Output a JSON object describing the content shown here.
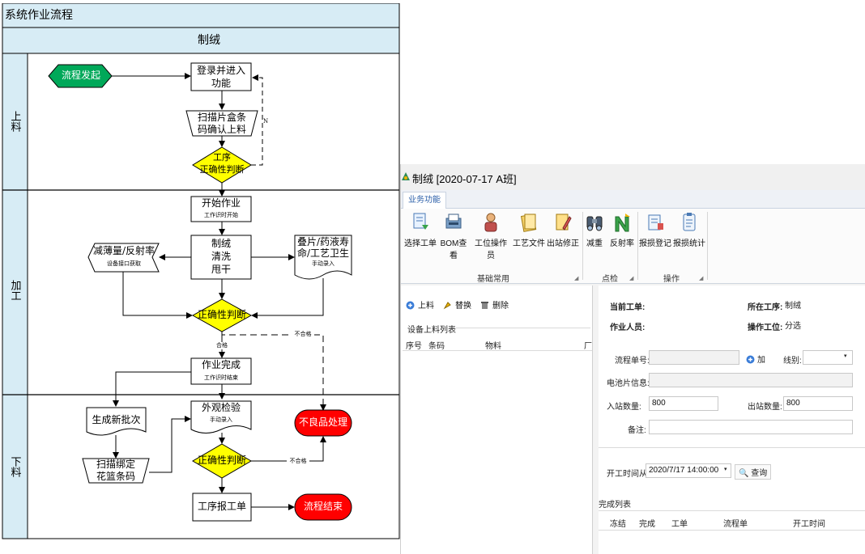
{
  "flowchart": {
    "title": "系统作业流程",
    "column_header": "制绒",
    "lanes": [
      "上料",
      "加工",
      "下料"
    ],
    "nodes": {
      "start": "流程发起",
      "login": [
        "登录并进入",
        "功能"
      ],
      "scan": [
        "扫描片盒条",
        "码确认上料"
      ],
      "check1": [
        "工序",
        "正确性判断"
      ],
      "check1_no": "N",
      "begin": "开始作业",
      "begin_sub": "工作识时开始",
      "process": [
        "制绒",
        "清洗",
        "甩干"
      ],
      "thin": "减薄量/反射率",
      "thin_sub": "设备接口获取",
      "stack": [
        "叠片/药液寿",
        "命/工艺卫生"
      ],
      "stack_sub": "手动录入",
      "check2": "正确性判断",
      "fail_label1": "不合格",
      "pass_label": "合格",
      "done": "作业完成",
      "done_sub": "工作识时结束",
      "new_batch": "生成新批次",
      "bind": [
        "扫描绑定",
        "花篮条码"
      ],
      "inspect": "外观检验",
      "inspect_sub": "手动录入",
      "defect": "不良品处理",
      "check3": "正确性判断",
      "fail_label2": "不合格",
      "report": "工序报工单",
      "end": "流程结束"
    },
    "colors": {
      "header_fill": "#d7ecf5",
      "start_fill": "#00a859",
      "diamond_fill": "#ffff00",
      "terminal_red": "#ff0000"
    }
  },
  "app": {
    "title": "制绒 [2020-07-17 A班]",
    "ribbon_tab": "业务功能",
    "ribbon_buttons": [
      {
        "label": "选择工单",
        "icon": "select-order-icon"
      },
      {
        "label": "BOM查看",
        "icon": "bom-icon"
      },
      {
        "label": "工位操作员",
        "icon": "operator-icon"
      },
      {
        "label": "工艺文件",
        "icon": "process-file-icon"
      },
      {
        "label": "出站修正",
        "icon": "exit-fix-icon"
      },
      {
        "label": "减重",
        "icon": "binoculars-icon"
      },
      {
        "label": "反射率",
        "icon": "reflectance-icon"
      },
      {
        "label": "报损登记",
        "icon": "loss-register-icon"
      },
      {
        "label": "报损统计",
        "icon": "loss-stats-icon"
      }
    ],
    "ribbon_groups": [
      "基础常用",
      "点检",
      "操作"
    ],
    "left_panel": {
      "buttons": [
        "上料",
        "替换",
        "删除"
      ],
      "list_title": "设备上料列表",
      "columns": [
        "序号",
        "条码",
        "物料",
        "厂"
      ]
    },
    "right_panel": {
      "current_order_label": "当前工单:",
      "current_order_value": "",
      "process_label": "所在工序:",
      "process_value": "制绒",
      "operator_label": "作业人员:",
      "operator_value": "",
      "station_label": "操作工位:",
      "station_value": "分选",
      "flow_no_label": "流程单号:",
      "flow_no_value": "",
      "add_label": "加",
      "line_label": "线别:",
      "line_value": "",
      "cell_info_label": "电池片信息:",
      "in_qty_label": "入站数量:",
      "in_qty_value": "800",
      "out_qty_label": "出站数量:",
      "out_qty_value": "800",
      "remark_label": "备注:",
      "start_time_label": "开工时间从:",
      "start_time_value": "2020/7/17 14:00:00",
      "query_label": "查询",
      "done_list_title": "完成列表",
      "done_columns": [
        "冻结",
        "完成",
        "工单",
        "流程单",
        "开工时间"
      ]
    }
  }
}
